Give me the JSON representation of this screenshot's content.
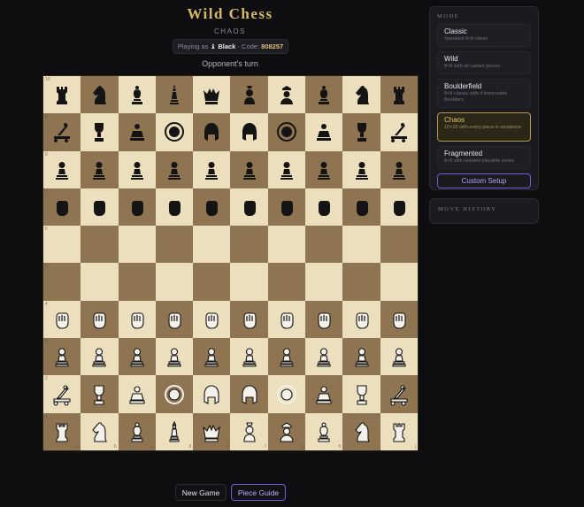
{
  "header": {
    "title": "Wild Chess",
    "mode": "CHAOS",
    "playing_as_prefix": "Playing as",
    "player_side": "♝ Black",
    "code_prefix": " · Code:",
    "code": "808257",
    "turn_status": "Opponent's turn"
  },
  "board": {
    "rows": [
      [
        {
          "p": "rook",
          "c": "black"
        },
        {
          "p": "knight",
          "c": "black"
        },
        {
          "p": "bishop",
          "c": "black"
        },
        {
          "p": "queen-pawn",
          "c": "black"
        },
        {
          "p": "crown",
          "c": "black"
        },
        {
          "p": "king-bust",
          "c": "black"
        },
        {
          "p": "officer",
          "c": "black"
        },
        {
          "p": "bishop",
          "c": "black"
        },
        {
          "p": "knight",
          "c": "black"
        },
        {
          "p": "rook",
          "c": "black"
        }
      ],
      [
        {
          "p": "catapult",
          "c": "black"
        },
        {
          "p": "trophy",
          "c": "black"
        },
        {
          "p": "monk",
          "c": "black"
        },
        {
          "p": "shield-face",
          "c": "black"
        },
        {
          "p": "helmet",
          "c": "black"
        },
        {
          "p": "helmet",
          "c": "black"
        },
        {
          "p": "shield-face",
          "c": "black"
        },
        {
          "p": "monk",
          "c": "black"
        },
        {
          "p": "trophy",
          "c": "black"
        },
        {
          "p": "catapult",
          "c": "black"
        }
      ],
      [
        {
          "p": "pawn",
          "c": "black"
        },
        {
          "p": "pawn",
          "c": "black"
        },
        {
          "p": "pawn",
          "c": "black"
        },
        {
          "p": "pawn",
          "c": "black"
        },
        {
          "p": "pawn",
          "c": "black"
        },
        {
          "p": "pawn",
          "c": "black"
        },
        {
          "p": "pawn",
          "c": "black"
        },
        {
          "p": "pawn",
          "c": "black"
        },
        {
          "p": "pawn",
          "c": "black"
        },
        {
          "p": "pawn",
          "c": "black"
        }
      ],
      [
        {
          "p": "fist",
          "c": "black"
        },
        {
          "p": "fist",
          "c": "black"
        },
        {
          "p": "fist",
          "c": "black"
        },
        {
          "p": "fist",
          "c": "black"
        },
        {
          "p": "fist",
          "c": "black"
        },
        {
          "p": "fist",
          "c": "black"
        },
        {
          "p": "fist",
          "c": "black"
        },
        {
          "p": "fist",
          "c": "black"
        },
        {
          "p": "fist",
          "c": "black"
        },
        {
          "p": "fist",
          "c": "black"
        }
      ],
      [
        null,
        null,
        null,
        null,
        null,
        null,
        null,
        null,
        null,
        null
      ],
      [
        null,
        null,
        null,
        null,
        null,
        null,
        null,
        null,
        null,
        null
      ],
      [
        {
          "p": "fist",
          "c": "white"
        },
        {
          "p": "fist",
          "c": "white"
        },
        {
          "p": "fist",
          "c": "white"
        },
        {
          "p": "fist",
          "c": "white"
        },
        {
          "p": "fist",
          "c": "white"
        },
        {
          "p": "fist",
          "c": "white"
        },
        {
          "p": "fist",
          "c": "white"
        },
        {
          "p": "fist",
          "c": "white"
        },
        {
          "p": "fist",
          "c": "white"
        },
        {
          "p": "fist",
          "c": "white"
        }
      ],
      [
        {
          "p": "pawn",
          "c": "white"
        },
        {
          "p": "pawn",
          "c": "white"
        },
        {
          "p": "pawn",
          "c": "white"
        },
        {
          "p": "pawn",
          "c": "white"
        },
        {
          "p": "pawn",
          "c": "white"
        },
        {
          "p": "pawn",
          "c": "white"
        },
        {
          "p": "pawn",
          "c": "white"
        },
        {
          "p": "pawn",
          "c": "white"
        },
        {
          "p": "pawn",
          "c": "white"
        },
        {
          "p": "pawn",
          "c": "white"
        }
      ],
      [
        {
          "p": "catapult",
          "c": "white"
        },
        {
          "p": "trophy",
          "c": "white"
        },
        {
          "p": "monk",
          "c": "white"
        },
        {
          "p": "shield-face",
          "c": "white"
        },
        {
          "p": "helmet",
          "c": "white"
        },
        {
          "p": "helmet",
          "c": "white"
        },
        {
          "p": "shield-face",
          "c": "white"
        },
        {
          "p": "monk",
          "c": "white"
        },
        {
          "p": "trophy",
          "c": "white"
        },
        {
          "p": "catapult",
          "c": "white"
        }
      ],
      [
        {
          "p": "rook",
          "c": "white"
        },
        {
          "p": "knight",
          "c": "white"
        },
        {
          "p": "bishop",
          "c": "white"
        },
        {
          "p": "queen-pawn",
          "c": "white"
        },
        {
          "p": "crown",
          "c": "white"
        },
        {
          "p": "king-bust",
          "c": "white"
        },
        {
          "p": "officer",
          "c": "white"
        },
        {
          "p": "bishop",
          "c": "white"
        },
        {
          "p": "knight",
          "c": "white"
        },
        {
          "p": "rook",
          "c": "white"
        }
      ]
    ],
    "rank_labels": [
      "10",
      "9",
      "8",
      "7",
      "6",
      "5",
      "4",
      "3",
      "2",
      "1"
    ],
    "file_labels": [
      "a",
      "b",
      "c",
      "d",
      "e",
      "f",
      "g",
      "h",
      "i",
      "j"
    ],
    "light_color": "#ecdfbd",
    "dark_color": "#8f7452"
  },
  "actions": {
    "new_game": "New Game",
    "piece_guide": "Piece Guide"
  },
  "mode_panel": {
    "heading": "MODE",
    "modes": [
      {
        "name": "Classic",
        "desc": "Standard 8×8 chess"
      },
      {
        "name": "Wild",
        "desc": "8×8 with all variant pieces"
      },
      {
        "name": "Boulderfield",
        "desc": "8×8 classic with 4 immovable Boulders"
      },
      {
        "name": "Chaos",
        "desc": "10×10 with every piece in existence"
      },
      {
        "name": "Fragmented",
        "desc": "8×8 with isolated playable zones"
      }
    ],
    "selected": "Chaos",
    "custom_setup": "Custom Setup"
  },
  "history_panel": {
    "heading": "MOVE HISTORY"
  },
  "colors": {
    "accent_gold": "#d9b86a",
    "accent_purple": "#6b5fd4",
    "background": "#0e0e10"
  }
}
